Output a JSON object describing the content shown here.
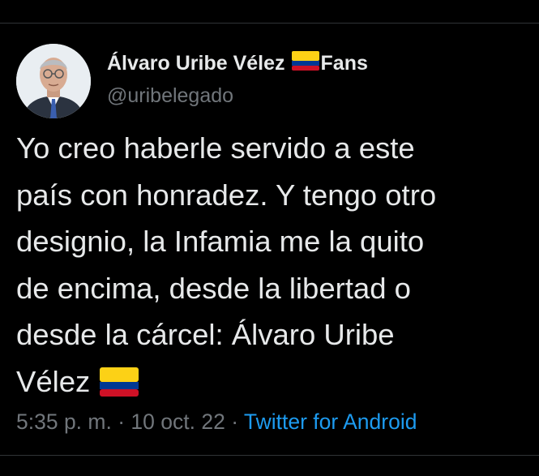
{
  "author": {
    "name": "Álvaro Uribe Vélez",
    "name_suffix": "Fans",
    "handle": "@uribelegado",
    "name_flag_icon": "colombia-flag-icon"
  },
  "tweet": {
    "lines": [
      "Yo creo haberle servido a este",
      "país con honradez. Y tengo otro",
      "designio, la Infamia me la quito",
      "de encima, desde la libertad o",
      "desde la cárcel: Álvaro Uribe",
      "Vélez"
    ],
    "trailing_emoji_icon": "colombia-flag-icon"
  },
  "meta": {
    "time": "5:35 p. m.",
    "separator": "·",
    "date": "10 oct. 22",
    "source": "Twitter for Android"
  },
  "colors": {
    "background": "#000000",
    "text_primary": "#e7e9ea",
    "text_secondary": "#71767b",
    "link": "#1d9bf0",
    "flag_yellow": "#fcd116",
    "flag_blue": "#003893",
    "flag_red": "#ce1126"
  }
}
